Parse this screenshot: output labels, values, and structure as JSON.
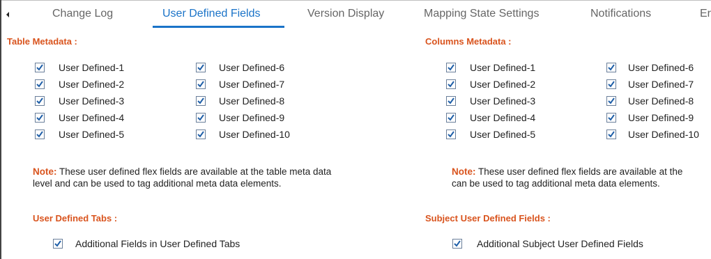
{
  "tabs": [
    {
      "label": "Change Log",
      "active": false
    },
    {
      "label": "User Defined Fields",
      "active": true
    },
    {
      "label": "Version Display",
      "active": false
    },
    {
      "label": "Mapping State Settings",
      "active": false
    },
    {
      "label": "Notifications",
      "active": false
    },
    {
      "label": "Er",
      "active": false
    }
  ],
  "colors": {
    "accent": "#1a73c8",
    "heading": "#d9541e",
    "check": "#1f5fa8"
  },
  "table_metadata": {
    "title": "Table Metadata :",
    "fields": [
      {
        "label": "User Defined-1",
        "checked": true
      },
      {
        "label": "User Defined-2",
        "checked": true
      },
      {
        "label": "User Defined-3",
        "checked": true
      },
      {
        "label": "User Defined-4",
        "checked": true
      },
      {
        "label": "User Defined-5",
        "checked": true
      },
      {
        "label": "User Defined-6",
        "checked": true
      },
      {
        "label": "User Defined-7",
        "checked": true
      },
      {
        "label": "User Defined-8",
        "checked": true
      },
      {
        "label": "User Defined-9",
        "checked": true
      },
      {
        "label": "User Defined-10",
        "checked": true
      }
    ],
    "note_label": "Note:",
    "note_line1": " These user defined flex fields are available at the table meta data",
    "note_line2": "level and can be used to tag additional meta data elements."
  },
  "columns_metadata": {
    "title": "Columns Metadata :",
    "fields": [
      {
        "label": "User Defined-1",
        "checked": true
      },
      {
        "label": "User Defined-2",
        "checked": true
      },
      {
        "label": "User Defined-3",
        "checked": true
      },
      {
        "label": "User Defined-4",
        "checked": true
      },
      {
        "label": "User Defined-5",
        "checked": true
      },
      {
        "label": "User Defined-6",
        "checked": true
      },
      {
        "label": "User Defined-7",
        "checked": true
      },
      {
        "label": "User Defined-8",
        "checked": true
      },
      {
        "label": "User Defined-9",
        "checked": true
      },
      {
        "label": "User Defined-10",
        "checked": true
      }
    ],
    "note_label": "Note:",
    "note_line1": " These user defined flex fields are available at the",
    "note_line2": "can be used to tag additional meta data elements."
  },
  "user_defined_tabs": {
    "title": "User Defined Tabs :",
    "option": {
      "label": "Additional Fields in User Defined Tabs",
      "checked": true
    }
  },
  "subject_user_defined_fields": {
    "title": "Subject User Defined Fields :",
    "option": {
      "label": "Additional Subject User Defined Fields",
      "checked": true
    }
  }
}
